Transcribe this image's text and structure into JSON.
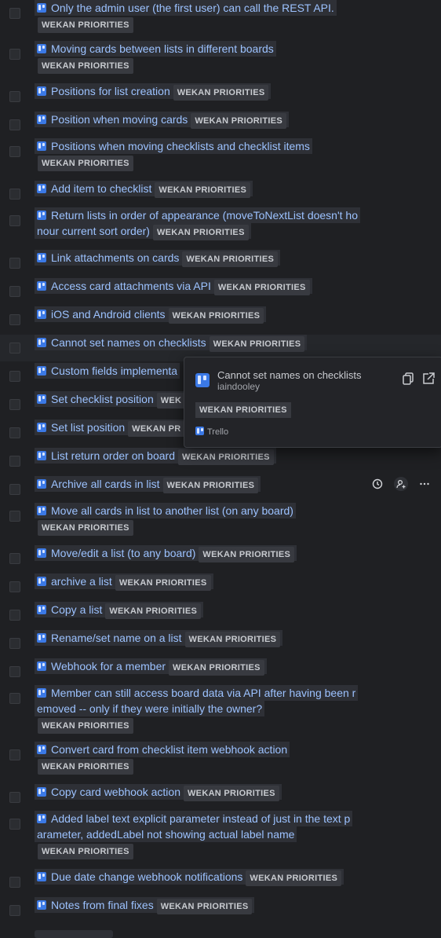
{
  "popover": {
    "title": "Cannot set names on checklists",
    "user": "iaindooley",
    "badge": "WEKAN PRIORITIES",
    "source": "Trello"
  },
  "items": [
    {
      "lines": [
        "Only the admin user (the first user) can call the REST API."
      ],
      "badge": "WEKAN PRIORITIES",
      "badge_own": true
    },
    {
      "lines": [
        "Moving cards between lists in different boards"
      ],
      "badge": "WEKAN PRIORITIES",
      "badge_own": true
    },
    {
      "lines": [
        "Positions for list creation"
      ],
      "badge": "WEKAN PRIORITIES"
    },
    {
      "lines": [
        "Position when moving cards"
      ],
      "badge": "WEKAN PRIORITIES"
    },
    {
      "lines": [
        "Positions when moving checklists and checklist items"
      ],
      "badge": "WEKAN PRIORITIES",
      "badge_own": true
    },
    {
      "lines": [
        "Add item to checklist"
      ],
      "badge": "WEKAN PRIORITIES"
    },
    {
      "lines": [
        "Return lists in order of appearance (moveToNextList doesn't ho",
        "nour current sort order)"
      ],
      "badge": "WEKAN PRIORITIES"
    },
    {
      "lines": [
        "Link attachments on cards"
      ],
      "badge": "WEKAN PRIORITIES"
    },
    {
      "lines": [
        "Access card attachments via API"
      ],
      "badge": "WEKAN PRIORITIES"
    },
    {
      "lines": [
        "iOS and Android clients"
      ],
      "badge": "WEKAN PRIORITIES"
    },
    {
      "lines": [
        "Cannot set names on checklists"
      ],
      "badge": "WEKAN PRIORITIES",
      "hover": true
    },
    {
      "lines": [
        "Custom fields implementa"
      ],
      "badge": ""
    },
    {
      "lines": [
        "Set checklist position"
      ],
      "badge": "WEK"
    },
    {
      "lines": [
        "Set list position"
      ],
      "badge": "WEKAN PR"
    },
    {
      "lines": [
        "List return order on board"
      ],
      "badge": "WEKAN PRIORITIES"
    },
    {
      "lines": [
        "Archive all cards in list"
      ],
      "badge": "WEKAN PRIORITIES",
      "actions": true
    },
    {
      "lines": [
        "Move all cards in list to another list (on any board)"
      ],
      "badge": "WEKAN PRIORITIES",
      "badge_own": true
    },
    {
      "lines": [
        "Move/edit a list (to any board)"
      ],
      "badge": "WEKAN PRIORITIES"
    },
    {
      "lines": [
        "archive a list"
      ],
      "badge": "WEKAN PRIORITIES"
    },
    {
      "lines": [
        "Copy a list"
      ],
      "badge": "WEKAN PRIORITIES"
    },
    {
      "lines": [
        "Rename/set name on a list"
      ],
      "badge": "WEKAN PRIORITIES"
    },
    {
      "lines": [
        "Webhook for a member"
      ],
      "badge": "WEKAN PRIORITIES"
    },
    {
      "lines": [
        "Member can still access board data via API after having been r",
        "emoved -- only if they were initially the owner?"
      ],
      "badge": "WEKAN PRIORITIES",
      "badge_own": true
    },
    {
      "lines": [
        "Convert card from checklist item webhook action"
      ],
      "badge": "WEKAN PRIORITIES",
      "badge_own": true
    },
    {
      "lines": [
        "Copy card webhook action"
      ],
      "badge": "WEKAN PRIORITIES"
    },
    {
      "lines": [
        "Added label text explicit parameter instead of just in the text p",
        "arameter, addedLabel not showing actual label name"
      ],
      "badge": "WEKAN PRIORITIES",
      "badge_own": true
    },
    {
      "lines": [
        "Due date change webhook notifications"
      ],
      "badge": "WEKAN PRIORITIES"
    },
    {
      "lines": [
        "Notes from final fixes"
      ],
      "badge": "WEKAN PRIORITIES"
    }
  ]
}
